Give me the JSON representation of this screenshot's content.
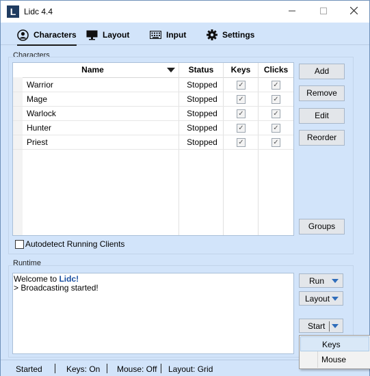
{
  "window": {
    "title": "Lidc 4.4",
    "icon_letter": "L"
  },
  "tabs": [
    {
      "label": "Characters",
      "icon": "person-icon",
      "active": true
    },
    {
      "label": "Layout",
      "icon": "monitor-icon"
    },
    {
      "label": "Input",
      "icon": "keyboard-icon"
    },
    {
      "label": "Settings",
      "icon": "gear-icon"
    }
  ],
  "characters": {
    "group_label": "Characters",
    "columns": {
      "name": "Name",
      "status": "Status",
      "keys": "Keys",
      "clicks": "Clicks"
    },
    "rows": [
      {
        "name": "Warrior",
        "status": "Stopped",
        "keys": true,
        "clicks": true
      },
      {
        "name": "Mage",
        "status": "Stopped",
        "keys": true,
        "clicks": true
      },
      {
        "name": "Warlock",
        "status": "Stopped",
        "keys": true,
        "clicks": true
      },
      {
        "name": "Hunter",
        "status": "Stopped",
        "keys": true,
        "clicks": true
      },
      {
        "name": "Priest",
        "status": "Stopped",
        "keys": true,
        "clicks": true
      }
    ],
    "buttons": {
      "add": "Add",
      "remove": "Remove",
      "edit": "Edit",
      "reorder": "Reorder",
      "groups": "Groups"
    },
    "autodetect_label": "Autodetect Running Clients",
    "autodetect_checked": false
  },
  "runtime": {
    "group_label": "Runtime",
    "log": {
      "welcome_prefix": "Welcome to ",
      "welcome_brand": "Lidc!",
      "line2": "> Broadcasting started!"
    },
    "buttons": {
      "run": "Run",
      "layout": "Layout",
      "start": "Start"
    },
    "start_menu": [
      "Keys",
      "Mouse"
    ]
  },
  "statusbar": {
    "state": "Started",
    "keys": "Keys: On",
    "mouse": "Mouse: Off",
    "layout": "Layout: Grid"
  },
  "colors": {
    "accent": "#2f6dbb",
    "window_bg": "#d2e4fa",
    "brand_text": "#1a4fa0"
  }
}
